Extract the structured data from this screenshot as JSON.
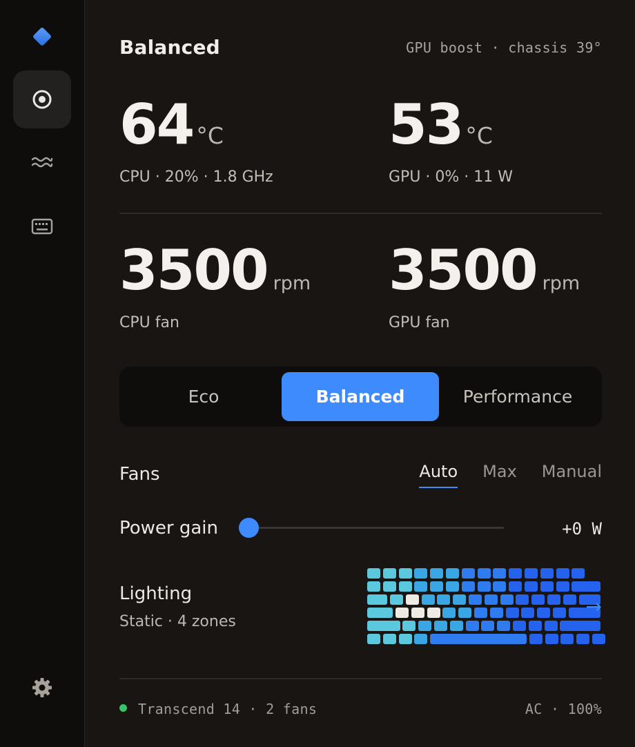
{
  "app": {
    "accent": "#3d8bfd",
    "status_ok_color": "#35c46a"
  },
  "sidebar": {
    "logo_icon": "diamond-logo-icon",
    "items": [
      {
        "name": "monitor",
        "icon": "target-icon",
        "active": true
      },
      {
        "name": "fans",
        "icon": "waves-icon",
        "active": false
      },
      {
        "name": "keyboard",
        "icon": "keyboard-icon",
        "active": false
      }
    ],
    "settings_icon": "gear-icon"
  },
  "header": {
    "title": "Balanced",
    "status": "GPU boost · chassis 39°"
  },
  "metrics": {
    "cpu_temp": {
      "value": "64",
      "unit": "°C",
      "sub": "CPU · 20% · 1.8 GHz"
    },
    "gpu_temp": {
      "value": "53",
      "unit": "°C",
      "sub": "GPU · 0% · 11 W"
    },
    "cpu_fan": {
      "value": "3500",
      "unit": "rpm",
      "sub": "CPU fan"
    },
    "gpu_fan": {
      "value": "3500",
      "unit": "rpm",
      "sub": "GPU fan"
    }
  },
  "modes": {
    "items": [
      "Eco",
      "Balanced",
      "Performance"
    ],
    "selected": "Balanced"
  },
  "fans": {
    "label": "Fans",
    "tabs": [
      "Auto",
      "Max",
      "Manual"
    ],
    "selected": "Auto"
  },
  "power": {
    "label": "Power gain",
    "value": "+0 W",
    "slider_fraction": 0
  },
  "lighting": {
    "label": "Lighting",
    "sub": "Static · 4 zones",
    "arrow": "→",
    "zone_colors": [
      "#5cc8de",
      "#3aa6e4",
      "#2f7cf0",
      "#2563ee"
    ],
    "highlight_color": "#efeae4"
  },
  "footer": {
    "device": "Transcend 14 · 2 fans",
    "power": "AC · 100%"
  }
}
